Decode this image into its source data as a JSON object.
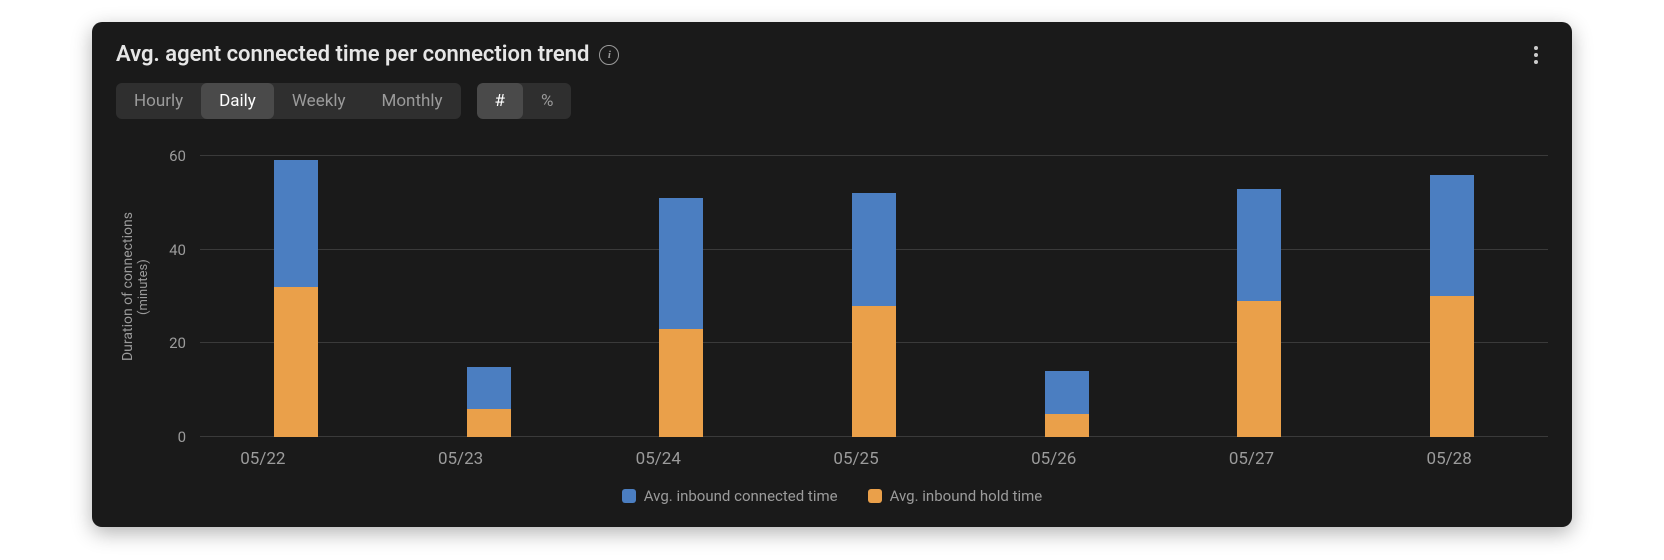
{
  "header": {
    "title": "Avg. agent connected time per connection trend"
  },
  "controls": {
    "granularity": [
      "Hourly",
      "Daily",
      "Weekly",
      "Monthly"
    ],
    "granularity_active": 1,
    "mode": [
      "#",
      "%"
    ],
    "mode_active": 0
  },
  "axis": {
    "ylabel_main": "Duration of connections",
    "ylabel_sub": "(minutes)",
    "yticks": [
      0,
      20,
      40,
      60
    ],
    "ymax": 64
  },
  "legend": {
    "top": "Avg. inbound connected time",
    "bottom": "Avg. inbound hold time"
  },
  "colors": {
    "top": "#4b7ec1",
    "bottom": "#eaa04a"
  },
  "chart_data": {
    "type": "bar",
    "stacked": true,
    "categories": [
      "05/22",
      "05/23",
      "05/24",
      "05/25",
      "05/26",
      "05/27",
      "05/28"
    ],
    "series": [
      {
        "name": "Avg. inbound hold time",
        "values": [
          32,
          6,
          23,
          28,
          5,
          29,
          30
        ]
      },
      {
        "name": "Avg. inbound connected time",
        "values": [
          27,
          9,
          28,
          24,
          9,
          24,
          26
        ]
      }
    ],
    "title": "Avg. agent connected time per connection trend",
    "xlabel": "",
    "ylabel": "Duration of connections (minutes)",
    "ylim": [
      0,
      64
    ]
  }
}
